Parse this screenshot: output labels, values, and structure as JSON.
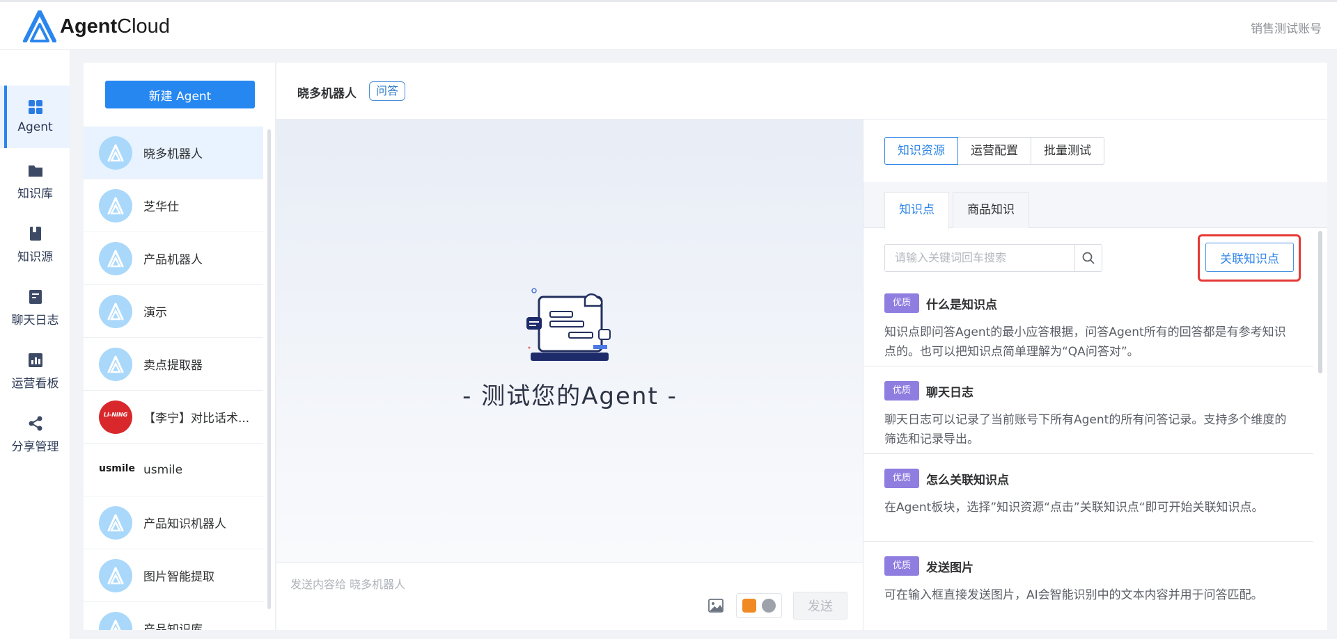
{
  "header": {
    "logo_bold": "Agent",
    "logo_light": "Cloud",
    "account": "销售测试账号"
  },
  "nav": {
    "items": [
      {
        "label": "Agent",
        "icon": "grid-icon"
      },
      {
        "label": "知识库",
        "icon": "folder-icon"
      },
      {
        "label": "知识源",
        "icon": "book-icon"
      },
      {
        "label": "聊天日志",
        "icon": "log-icon"
      },
      {
        "label": "运营看板",
        "icon": "chart-icon"
      },
      {
        "label": "分享管理",
        "icon": "share-icon"
      }
    ]
  },
  "agent_list": {
    "new_button": "新建 Agent",
    "items": [
      {
        "name": "晓多机器人"
      },
      {
        "name": "芝华仕"
      },
      {
        "name": "产品机器人"
      },
      {
        "name": "演示"
      },
      {
        "name": "卖点提取器"
      },
      {
        "name": "【李宁】对比话术..."
      },
      {
        "name": "usmile"
      },
      {
        "name": "产品知识机器人"
      },
      {
        "name": "图片智能提取"
      },
      {
        "name": "产品知识库"
      }
    ],
    "usmile_logo_text": "usmile",
    "lining_logo_text": "LI-NING"
  },
  "chat": {
    "title": "晓多机器人",
    "tag": "问答",
    "hint": "- 测试您的Agent -",
    "input_placeholder": "发送内容给 晓多机器人",
    "send": "发送"
  },
  "knowledge": {
    "segments": [
      "知识资源",
      "运营配置",
      "批量测试"
    ],
    "tabs": [
      "知识点",
      "商品知识"
    ],
    "search_placeholder": "请输入关键词回车搜索",
    "link_button": "关联知识点",
    "items": [
      {
        "badge": "优质",
        "title": "什么是知识点",
        "desc": "知识点即问答Agent的最小应答根据，问答Agent所有的回答都是有参考知识点的。也可以把知识点简单理解为“QA问答对”。"
      },
      {
        "badge": "优质",
        "title": "聊天日志",
        "desc": "聊天日志可以记录了当前账号下所有Agent的所有问答记录。支持多个维度的筛选和记录导出。"
      },
      {
        "badge": "优质",
        "title": "怎么关联知识点",
        "desc": "在Agent板块，选择”知识资源“点击”关联知识点“即可开始关联知识点。"
      },
      {
        "badge": "优质",
        "title": "发送图片",
        "desc": "可在输入框直接发送图片，AI会智能识别中的文本内容并用于问答匹配。"
      }
    ]
  },
  "colors": {
    "primary": "#2687f1",
    "badge": "#8f7de0",
    "highlight_frame": "#e53935"
  }
}
